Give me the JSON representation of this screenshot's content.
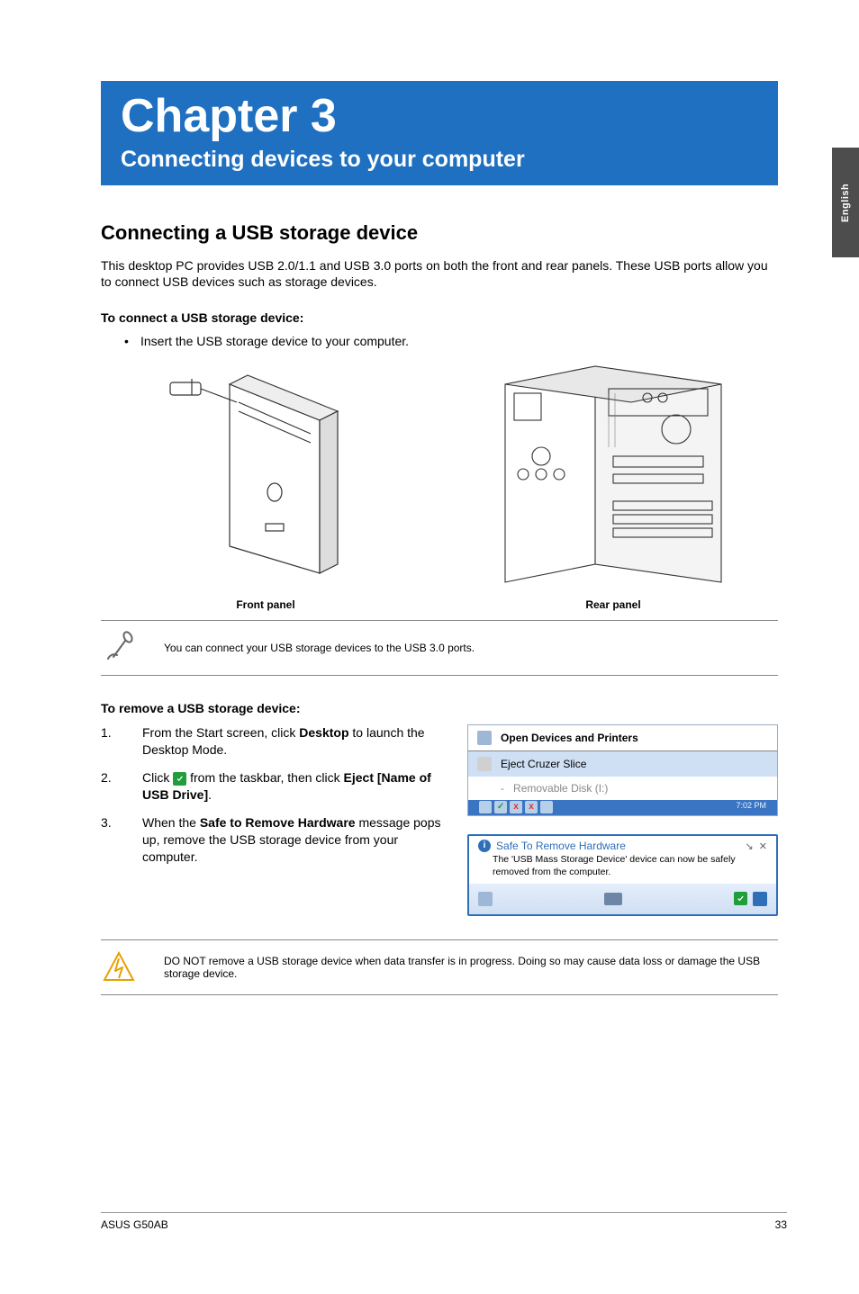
{
  "side_tab": "English",
  "chapter": {
    "title": "Chapter 3",
    "subtitle": "Connecting devices to your computer"
  },
  "section_heading": "Connecting a USB storage device",
  "intro_paragraph": "This desktop PC provides USB 2.0/1.1 and USB 3.0 ports on both the front and rear panels. These USB ports allow you to connect USB devices such as storage devices.",
  "connect_heading": "To connect a USB storage device:",
  "connect_bullet": "Insert the USB storage device to your computer.",
  "panel_labels": {
    "front": "Front panel",
    "rear": "Rear panel"
  },
  "note_usb30": "You can connect your USB storage devices to the USB 3.0 ports.",
  "remove_heading": "To remove a USB storage device:",
  "remove_steps": {
    "step1_pre": "From the Start screen, click ",
    "step1_bold": "Desktop",
    "step1_post": " to launch the Desktop Mode.",
    "step2_pre": "Click ",
    "step2_mid": " from the taskbar, then click ",
    "step2_bold": "Eject [Name of USB Drive]",
    "step2_post": ".",
    "step3_pre": "When the ",
    "step3_bold": "Safe to Remove Hardware",
    "step3_post": " message pops up, remove the USB storage device from your computer."
  },
  "screenshot1": {
    "row1": "Open Devices and Printers",
    "row2": "Eject Cruzer Slice",
    "row3_dash": "-",
    "row3": "Removable Disk (I:)",
    "time": "7:02 PM"
  },
  "screenshot2": {
    "title": "Safe To Remove Hardware",
    "body": "The 'USB Mass Storage Device' device can now be safely removed from the computer.",
    "close_glyph_a": "↘",
    "close_glyph_b": "✕"
  },
  "warning_text": "DO NOT remove a USB storage device when data transfer is in progress. Doing so may cause data loss or damage the USB storage device.",
  "footer": {
    "left": "ASUS G50AB",
    "right": "33"
  }
}
